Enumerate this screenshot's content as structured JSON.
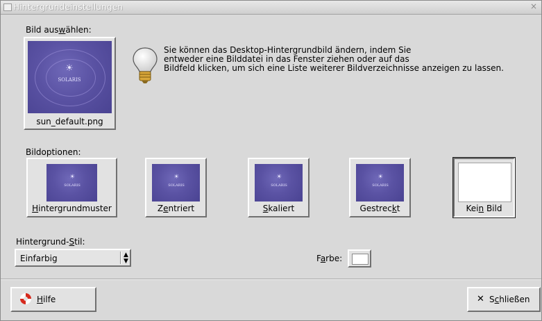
{
  "window": {
    "title": "Hintergrundeinstellungen",
    "close_glyph": "×"
  },
  "select_image": {
    "label_pre": "Bild aus",
    "label_mnemonic": "w",
    "label_post": "ählen:",
    "current_file": "sun_default.png",
    "logo_text": "SOLARIS"
  },
  "hint": {
    "icon": "lightbulb-icon",
    "text": "Sie können das Desktop-Hintergrundbild ändern, indem Sie\nentweder eine Bilddatei in das Fenster ziehen oder auf das\nBildfeld klicken, um sich eine Liste weiterer Bildverzeichnisse anzeigen zu lassen."
  },
  "image_options": {
    "label": "Bildoptionen:",
    "options": [
      {
        "pre": "",
        "mnemonic": "H",
        "post": "intergrundmuster"
      },
      {
        "pre": "Z",
        "mnemonic": "e",
        "post": "ntriert"
      },
      {
        "pre": "",
        "mnemonic": "S",
        "post": "kaliert"
      },
      {
        "pre": "Gestrec",
        "mnemonic": "k",
        "post": "t"
      },
      {
        "pre": "Kei",
        "mnemonic": "n",
        "post": " Bild"
      }
    ]
  },
  "background_style": {
    "label_pre": "Hintergrund-",
    "label_mnemonic": "S",
    "label_post": "til:",
    "value": "Einfarbig",
    "arrows": "▲▼"
  },
  "color": {
    "label_pre": "F",
    "label_mnemonic": "a",
    "label_post": "rbe:",
    "swatch": "#ffffff"
  },
  "footer": {
    "help_pre": "",
    "help_mnemonic": "H",
    "help_post": "ilfe",
    "close_icon": "x-icon",
    "close_glyph": "✕",
    "close_pre": "S",
    "close_mnemonic": "c",
    "close_post": "hließen"
  }
}
